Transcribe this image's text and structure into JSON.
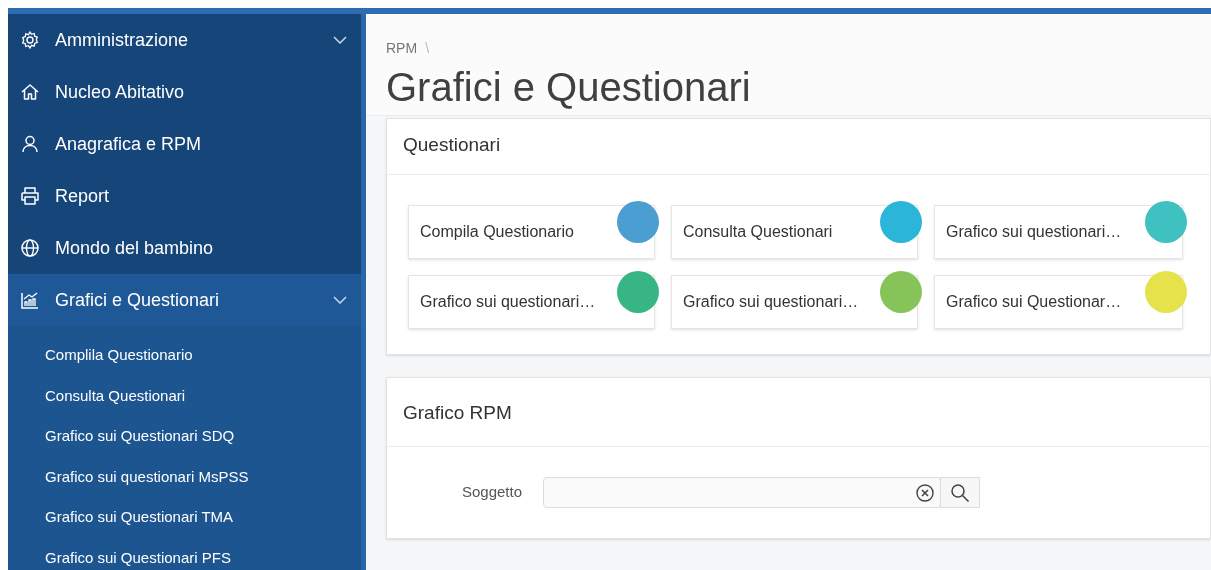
{
  "sidebar": {
    "items": [
      {
        "label": "Amministrazione",
        "has_submenu": true,
        "selected": false
      },
      {
        "label": "Nucleo Abitativo",
        "has_submenu": false,
        "selected": false
      },
      {
        "label": "Anagrafica e RPM",
        "has_submenu": false,
        "selected": false
      },
      {
        "label": "Report",
        "has_submenu": false,
        "selected": false
      },
      {
        "label": "Mondo del bambino",
        "has_submenu": false,
        "selected": false
      },
      {
        "label": "Grafici e Questionari",
        "has_submenu": true,
        "selected": true,
        "children": [
          {
            "label": "Complila Questionario",
            "selected": false
          },
          {
            "label": "Consulta Questionari",
            "selected": false
          },
          {
            "label": "Grafico sui Questionari SDQ",
            "selected": false
          },
          {
            "label": "Grafico sui questionari MsPSS",
            "selected": false
          },
          {
            "label": "Grafico sui Questionari TMA",
            "selected": false
          },
          {
            "label": "Grafico sui Questionari PFS",
            "selected": false
          }
        ]
      }
    ]
  },
  "breadcrumb": {
    "items": [
      "RPM"
    ],
    "separator": "\\"
  },
  "page_title": "Grafici e Questionari",
  "questionari": {
    "title": "Questionari",
    "tiles": [
      {
        "label": "Compila Questionario",
        "color": "#4a9ed1"
      },
      {
        "label": "Consulta Questionari",
        "color": "#2bb5d8"
      },
      {
        "label": "Grafico sui questionari…",
        "color": "#3fc1c1"
      },
      {
        "label": "Grafico sui questionari…",
        "color": "#38b584"
      },
      {
        "label": "Grafico sui questionari…",
        "color": "#86c45a"
      },
      {
        "label": "Grafico sui Questionar…",
        "color": "#e6e24c"
      }
    ]
  },
  "grafico_rpm": {
    "title": "Grafico RPM",
    "field": {
      "label": "Soggetto"
    }
  }
}
